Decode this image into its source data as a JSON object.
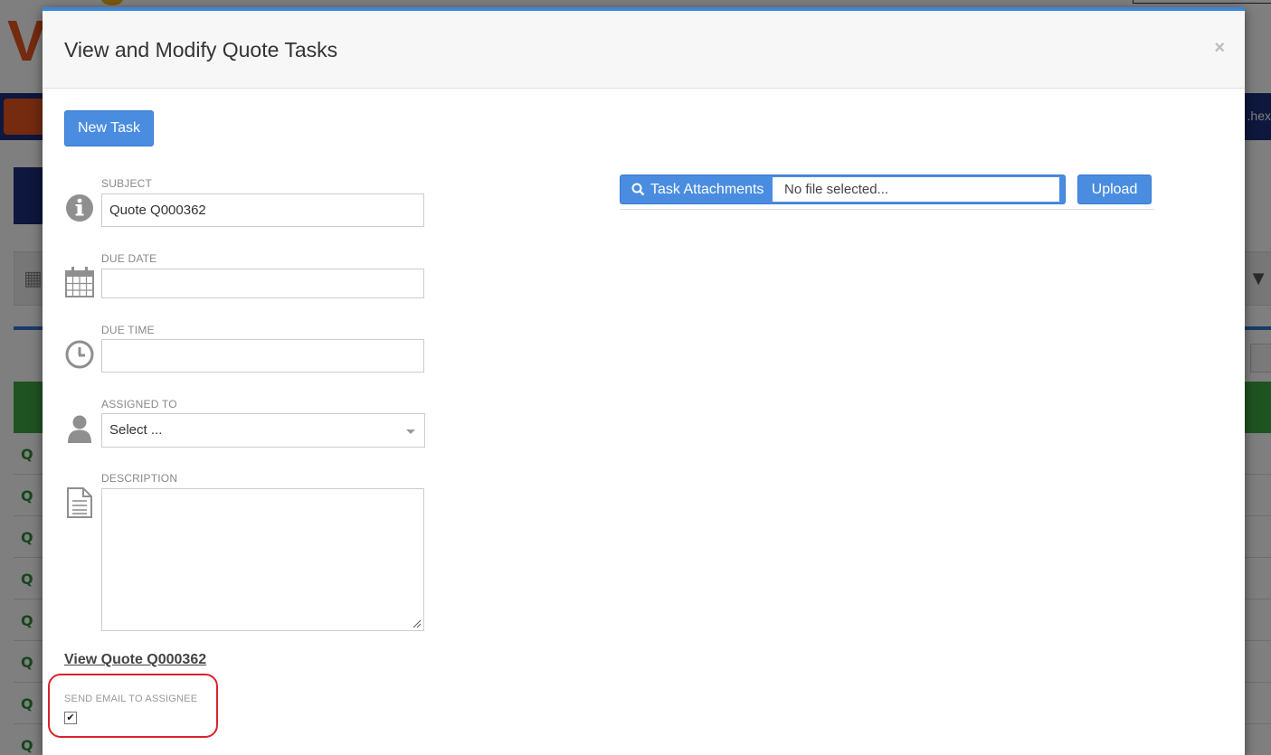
{
  "background": {
    "nav_text": ".hex"
  },
  "modal": {
    "title": "View and Modify Quote Tasks",
    "close_label": "×",
    "new_task_label": "New Task",
    "fields": {
      "subject": {
        "label": "SUBJECT",
        "value": "Quote Q000362",
        "icon": "info-icon"
      },
      "due_date": {
        "label": "DUE DATE",
        "value": "",
        "icon": "calendar-icon"
      },
      "due_time": {
        "label": "DUE TIME",
        "value": "",
        "icon": "clock-icon"
      },
      "assigned_to": {
        "label": "ASSIGNED TO",
        "value": "Select ...",
        "icon": "user-icon"
      },
      "description": {
        "label": "DESCRIPTION",
        "value": "",
        "icon": "document-icon"
      }
    },
    "view_quote_link": "View Quote Q000362",
    "send_email": {
      "label": "SEND EMAIL TO ASSIGNEE",
      "checked": true,
      "check_glyph": "✔"
    },
    "attachments": {
      "button_label": "Task Attachments",
      "file_text": "No file selected...",
      "upload_label": "Upload"
    }
  },
  "colors": {
    "primary": "#4a8de0",
    "header_accent": "#3b86d8",
    "highlight_border": "#d9232d"
  }
}
